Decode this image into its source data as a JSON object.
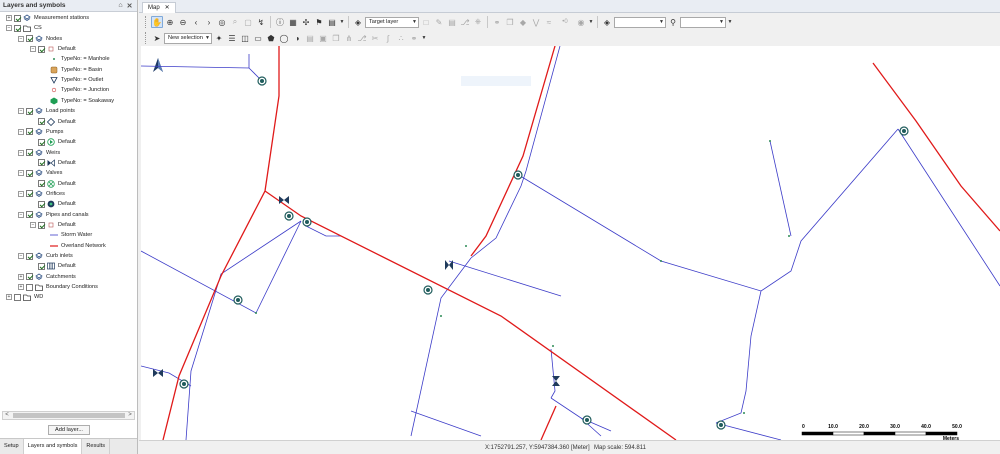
{
  "panel": {
    "title": "Layers and symbols",
    "pin_glyph": "⌂",
    "close_glyph": "✕"
  },
  "tree": [
    {
      "depth": 0,
      "expander": "+",
      "checkbox": true,
      "icon": "layer-stack-icon",
      "label": "Measurement stations"
    },
    {
      "depth": 0,
      "expander": "−",
      "checkbox": true,
      "icon": "folder-icon",
      "label": "CS"
    },
    {
      "depth": 1,
      "expander": "−",
      "checkbox": true,
      "icon": "layer-stack-icon",
      "label": "Nodes"
    },
    {
      "depth": 2,
      "expander": "−",
      "checkbox": true,
      "icon": "default-square-icon",
      "label": "Default"
    },
    {
      "depth": 3,
      "expander": "",
      "checkbox": false,
      "icon": "dot-icon",
      "label": "TypeNo: = Manhole"
    },
    {
      "depth": 3,
      "expander": "",
      "checkbox": false,
      "icon": "basin-icon",
      "label": "TypeNo: = Basin"
    },
    {
      "depth": 3,
      "expander": "",
      "checkbox": false,
      "icon": "outlet-triangle-icon",
      "label": "TypeNo: = Outlet"
    },
    {
      "depth": 3,
      "expander": "",
      "checkbox": false,
      "icon": "junction-circle-icon",
      "label": "TypeNo: = Junction"
    },
    {
      "depth": 3,
      "expander": "",
      "checkbox": false,
      "icon": "soakaway-hexagon-icon",
      "label": "TypeNo: = Soakaway"
    },
    {
      "depth": 1,
      "expander": "−",
      "checkbox": true,
      "icon": "layer-stack-icon",
      "label": "Load points"
    },
    {
      "depth": 2,
      "expander": "",
      "checkbox": true,
      "icon": "diamond-icon",
      "label": "Default"
    },
    {
      "depth": 1,
      "expander": "−",
      "checkbox": true,
      "icon": "layer-stack-icon",
      "label": "Pumps"
    },
    {
      "depth": 2,
      "expander": "",
      "checkbox": true,
      "icon": "pump-icon",
      "label": "Default"
    },
    {
      "depth": 1,
      "expander": "−",
      "checkbox": true,
      "icon": "layer-stack-icon",
      "label": "Weirs"
    },
    {
      "depth": 2,
      "expander": "",
      "checkbox": true,
      "icon": "weir-icon",
      "label": "Default"
    },
    {
      "depth": 1,
      "expander": "−",
      "checkbox": true,
      "icon": "layer-stack-icon",
      "label": "Valves"
    },
    {
      "depth": 2,
      "expander": "",
      "checkbox": true,
      "icon": "valve-icon",
      "label": "Default"
    },
    {
      "depth": 1,
      "expander": "−",
      "checkbox": true,
      "icon": "layer-stack-icon",
      "label": "Orifices"
    },
    {
      "depth": 2,
      "expander": "",
      "checkbox": true,
      "icon": "orifice-icon",
      "label": "Default"
    },
    {
      "depth": 1,
      "expander": "−",
      "checkbox": true,
      "icon": "layer-stack-icon",
      "label": "Pipes and canals"
    },
    {
      "depth": 2,
      "expander": "−",
      "checkbox": true,
      "icon": "default-square-icon",
      "label": "Default"
    },
    {
      "depth": 3,
      "expander": "",
      "checkbox": false,
      "icon": "blue-line-icon",
      "label": "Storm Water"
    },
    {
      "depth": 3,
      "expander": "",
      "checkbox": false,
      "icon": "red-line-icon",
      "label": "Overland Network"
    },
    {
      "depth": 1,
      "expander": "−",
      "checkbox": true,
      "icon": "layer-stack-icon",
      "label": "Curb inlets"
    },
    {
      "depth": 2,
      "expander": "",
      "checkbox": true,
      "icon": "curb-inlet-icon",
      "label": "Default"
    },
    {
      "depth": 1,
      "expander": "+",
      "checkbox": true,
      "icon": "layer-stack-icon",
      "label": "Catchments"
    },
    {
      "depth": 1,
      "expander": "+",
      "checkbox": false,
      "icon": "folder-icon",
      "label": "Boundary Conditions"
    },
    {
      "depth": 0,
      "expander": "+",
      "checkbox": false,
      "icon": "folder-icon",
      "label": "WD"
    }
  ],
  "scroll": {
    "left": "<",
    "right": ">"
  },
  "add_layer_label": "Add layer...",
  "bottom_tabs": [
    "Setup",
    "Layers and symbols",
    "Results"
  ],
  "active_bottom_tab": "Layers and symbols",
  "doc_tab": {
    "label": "Map",
    "close": "✕"
  },
  "toolbar": {
    "target_layer": "Target layer",
    "layer_combo": "",
    "search_combo": "",
    "selection_mode": "New selection",
    "snap_value": "0"
  },
  "status": {
    "coords": "X:1752791.257, Y:5947384.360 [Meter]",
    "scale": "Map scale: 594.811"
  },
  "scalebar": {
    "ticks": [
      "0",
      "10.0",
      "20.0",
      "30.0",
      "40.0",
      "50.0"
    ],
    "unit": "Meters"
  },
  "colors": {
    "storm_water": "#3c3cc8",
    "overland": "#e01a1a",
    "node": "#1f5c5c"
  }
}
